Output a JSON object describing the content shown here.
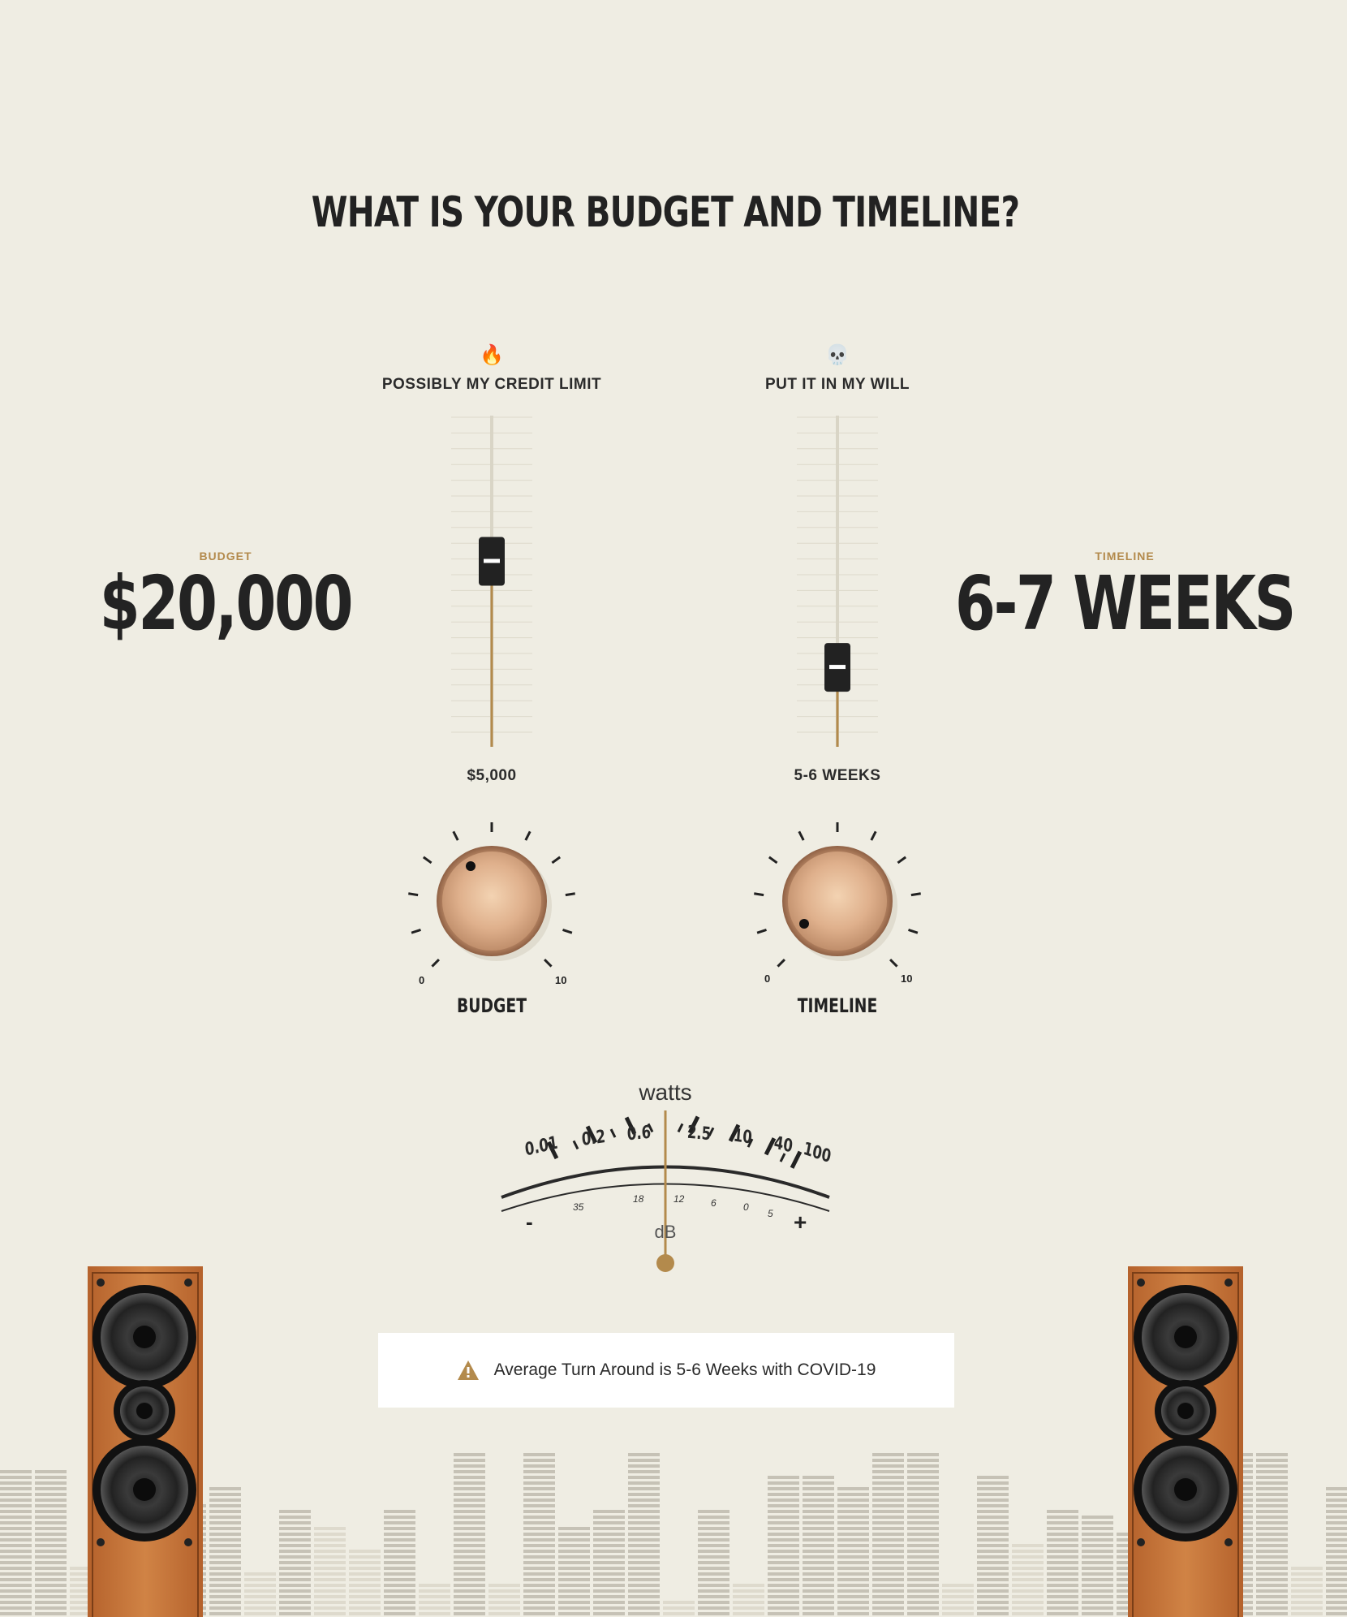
{
  "heading": "WHAT IS YOUR BUDGET AND TIMELINE?",
  "budget": {
    "label": "BUDGET",
    "value": "$20,000",
    "fader_top_label": "POSSIBLY MY CREDIT LIMIT",
    "fader_top_emoji": "🔥",
    "fader_bottom_label": "$5,000",
    "fader_level": 0.56,
    "knob_label": "BUDGET",
    "knob_min": "0",
    "knob_max": "10"
  },
  "timeline": {
    "label": "TIMELINE",
    "value": "6-7 WEEKS",
    "fader_top_label": "PUT IT IN MY WILL",
    "fader_top_emoji": "💀",
    "fader_bottom_label": "5-6 WEEKS",
    "fader_level": 0.24,
    "knob_label": "TIMELINE",
    "knob_min": "0",
    "knob_max": "10"
  },
  "meter": {
    "unit_top": "watts",
    "unit_bottom": "dB",
    "watt_scale": [
      "0.01",
      "0.2",
      "0.6",
      "2.5",
      "10",
      "40",
      "100"
    ],
    "db_scale": [
      "35",
      "18",
      "12",
      "6",
      "0",
      "5"
    ],
    "minus": "-",
    "plus": "+"
  },
  "notice": {
    "icon": "warning-icon",
    "text": "Average Turn Around is 5-6 Weeks with COVID-19"
  },
  "colors": {
    "background": "#efede3",
    "accent": "#b38a4c",
    "dark": "#232323",
    "wood": "#c8773e"
  }
}
